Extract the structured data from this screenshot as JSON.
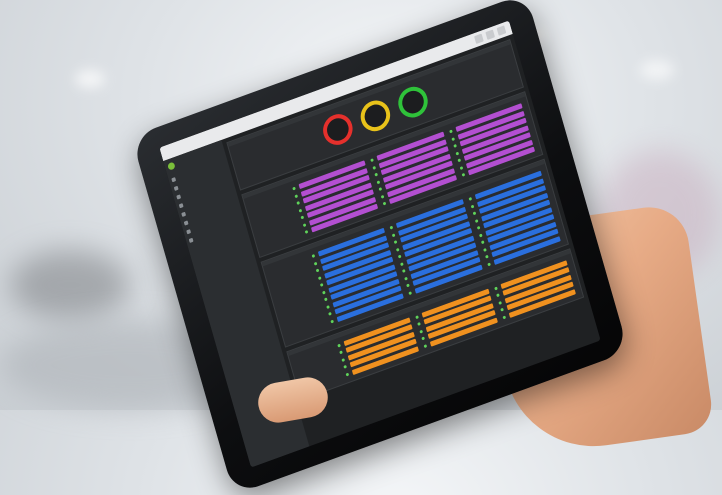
{
  "browser": {
    "user_label": "",
    "controls": [
      "minimize",
      "maximize",
      "close"
    ]
  },
  "sidebar": {
    "logo_text": "",
    "items": [
      "",
      "",
      "",
      "",
      "",
      "",
      "",
      ""
    ]
  },
  "panels": {
    "gauges": {
      "title": "",
      "items": [
        {
          "color": "#e5302c",
          "value": ""
        },
        {
          "color": "#e8c21a",
          "value": ""
        },
        {
          "color": "#2fc23a",
          "value": ""
        }
      ]
    },
    "purple": {
      "title": "",
      "rows": 7,
      "columns": 3,
      "color": "#b34fd1"
    },
    "blue": {
      "title": "",
      "rows": 10,
      "columns": 3,
      "color": "#2a6fde"
    },
    "orange": {
      "title": "",
      "rows": 5,
      "columns": 3,
      "color": "#f0911f"
    }
  },
  "colors": {
    "screen_bg": "#1f2123",
    "sidebar_bg": "#2b2e31",
    "accent_green": "#7bbf3a",
    "ok_dot": "#5fd35a"
  }
}
